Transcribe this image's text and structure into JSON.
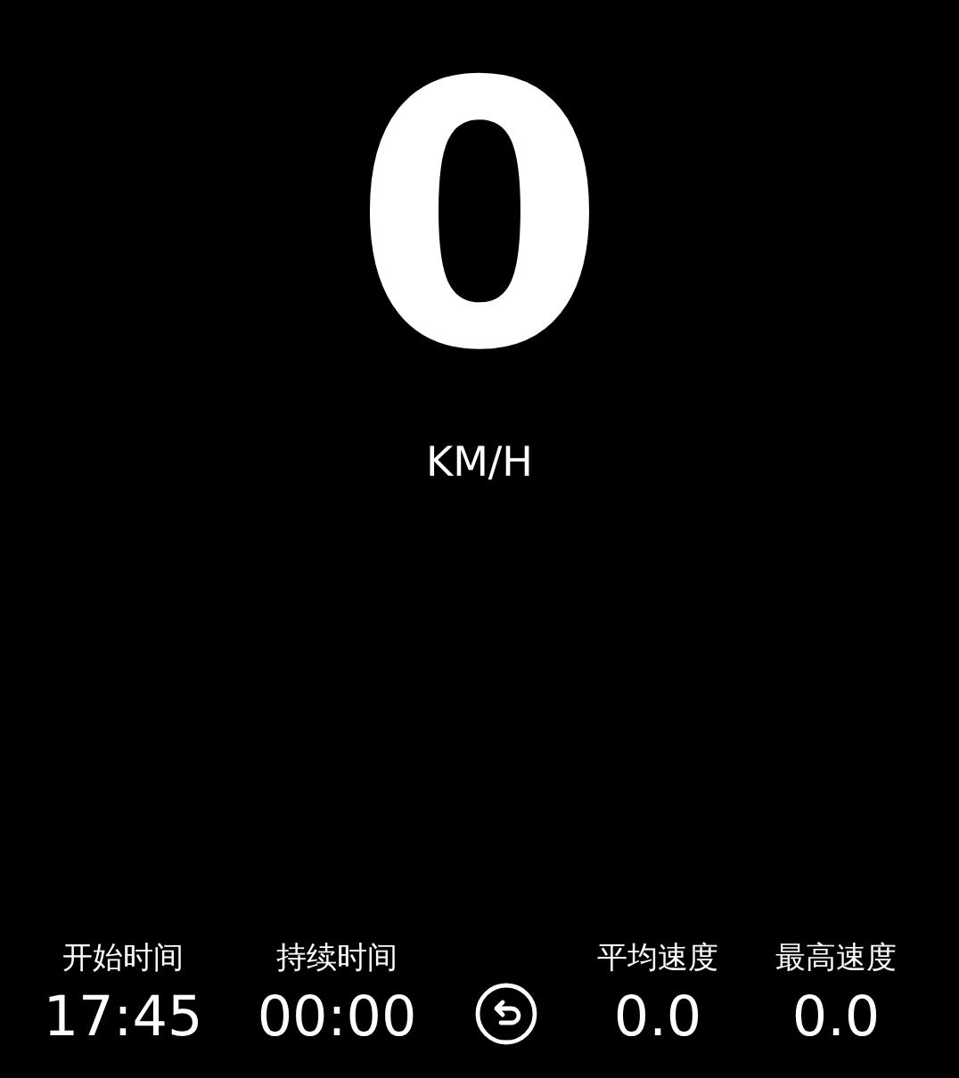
{
  "speedometer": {
    "digit": "0",
    "unit": "KM/H"
  },
  "stats": [
    {
      "label": "开始时间",
      "value": "17:45"
    },
    {
      "label": "持续时间",
      "value": "00:00"
    },
    {
      "label": "平均速度",
      "value": "0.0"
    },
    {
      "label": "最高速度",
      "value": "0.0"
    }
  ]
}
